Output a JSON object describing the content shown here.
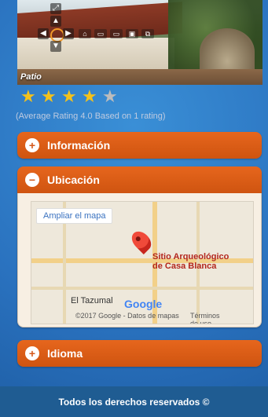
{
  "gallery": {
    "caption": "Patio",
    "controls": [
      "fullscreen-icon",
      "home-icon",
      "view-icons"
    ]
  },
  "rating": {
    "value": 4.0,
    "max": 5,
    "text": "(Average Rating 4.0 Based on 1 rating)"
  },
  "sections": [
    {
      "id": "info",
      "label": "Información",
      "state": "collapsed",
      "sign": "+"
    },
    {
      "id": "location",
      "label": "Ubicación",
      "state": "expanded",
      "sign": "−"
    },
    {
      "id": "language",
      "label": "Idioma",
      "state": "collapsed",
      "sign": "+"
    }
  ],
  "map": {
    "expand_button": "Ampliar el mapa",
    "site_line1": "Sitio Arqueológico",
    "site_line2": "de Casa Blanca",
    "place": "El Tazumal",
    "copyright": "©2017 Google - Datos de mapas",
    "terms": "Términos de uso",
    "google_logo": "Google"
  },
  "footer": {
    "text": "Todos los derechos reservados ©"
  },
  "colors": {
    "accent": "#e3621c",
    "background": "#2a72bf",
    "footer": "#1f5c92"
  }
}
